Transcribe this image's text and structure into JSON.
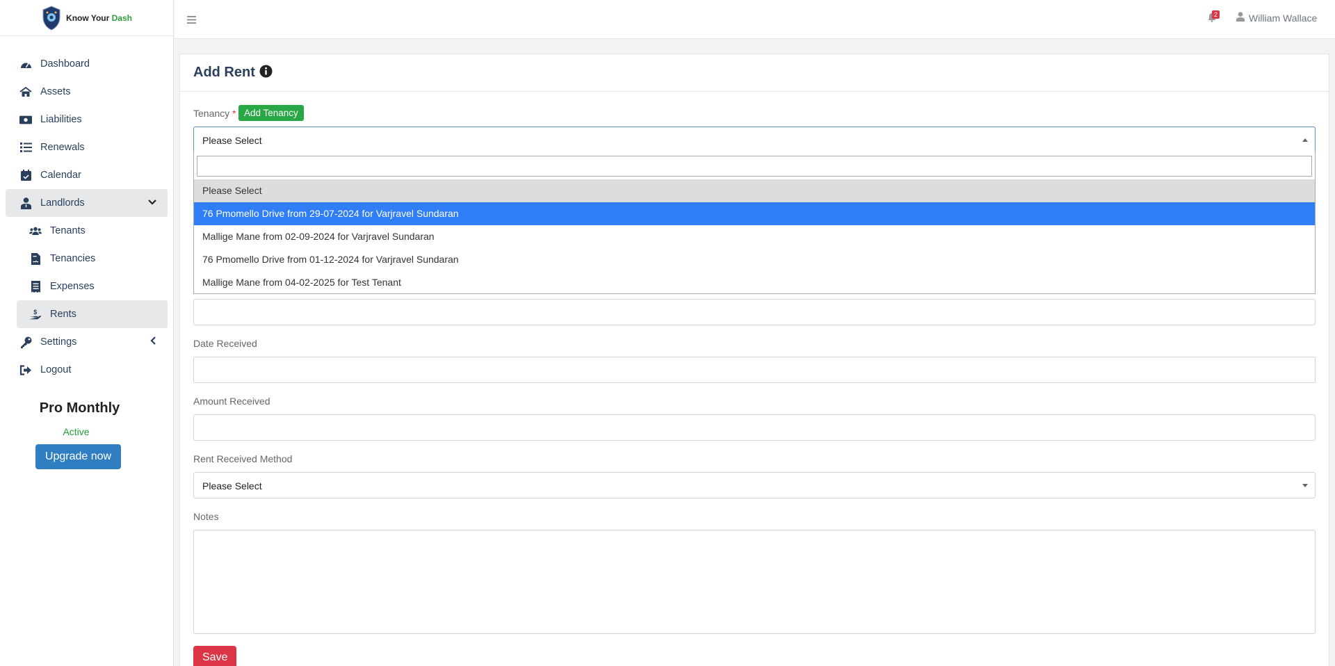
{
  "brand": {
    "name_part1": "Know Your ",
    "name_part2": "Dash"
  },
  "sidebar": {
    "items": [
      {
        "label": "Dashboard"
      },
      {
        "label": "Assets"
      },
      {
        "label": "Liabilities"
      },
      {
        "label": "Renewals"
      },
      {
        "label": "Calendar"
      },
      {
        "label": "Landlords"
      },
      {
        "label": "Settings"
      },
      {
        "label": "Logout"
      }
    ],
    "sub_items": [
      {
        "label": "Tenants"
      },
      {
        "label": "Tenancies"
      },
      {
        "label": "Expenses"
      },
      {
        "label": "Rents"
      }
    ]
  },
  "plan": {
    "title": "Pro Monthly",
    "status": "Active",
    "upgrade_label": "Upgrade now"
  },
  "topbar": {
    "notification_count": "2",
    "user_name": "William Wallace"
  },
  "page": {
    "title": "Add Rent"
  },
  "form": {
    "tenancy_label": "Tenancy",
    "required_mark": "*",
    "add_tenancy_label": "Add Tenancy",
    "tenancy_value": "Please Select",
    "date_received_label": "Date Received",
    "amount_received_label": "Amount Received",
    "method_label": "Rent Received Method",
    "method_value": "Please Select",
    "notes_label": "Notes",
    "save_label": "Save"
  },
  "dropdown": {
    "options": [
      "Please Select",
      "76 Pmomello Drive from 29-07-2024 for Varjravel Sundaran",
      "Mallige Mane from 02-09-2024 for Varjravel Sundaran",
      "76 Pmomello Drive from 01-12-2024 for Varjravel Sundaran",
      "Mallige Mane from 04-02-2025 for Test Tenant"
    ]
  },
  "colors": {
    "accent": "#2f7ef6",
    "nav_text": "#2a3f5c",
    "save": "#dc3545",
    "add": "#28a745",
    "upgrade": "#2f7ec2"
  }
}
